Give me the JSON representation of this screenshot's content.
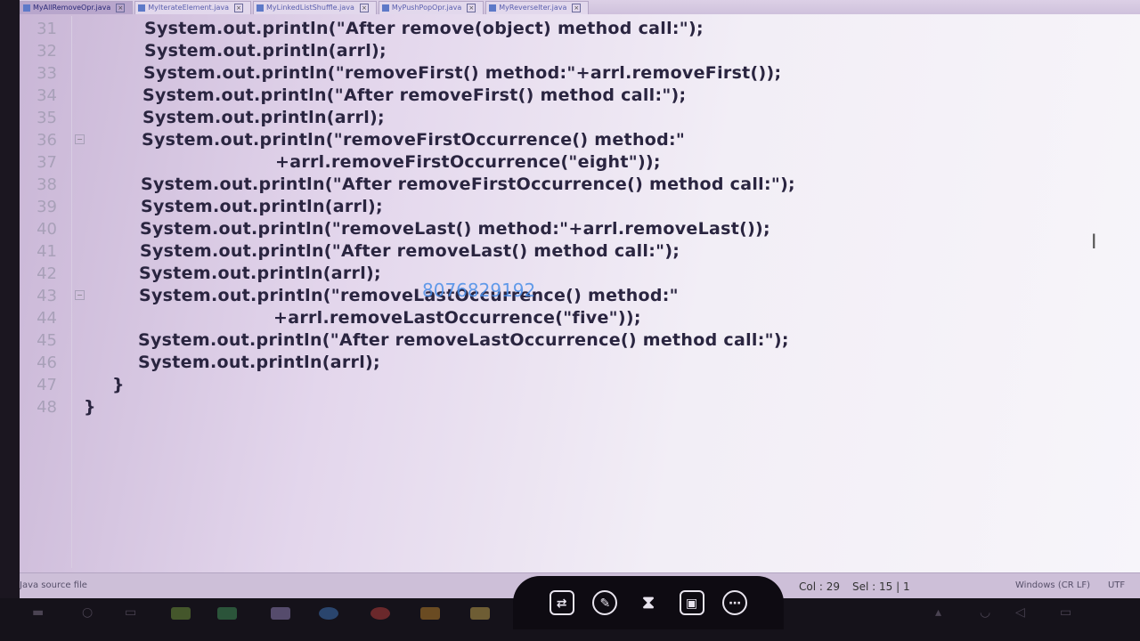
{
  "tabs": [
    {
      "label": "MyAllRemoveOpr.java",
      "active": true
    },
    {
      "label": "MyIterateElement.java",
      "active": false
    },
    {
      "label": "MyLinkedListShuffle.java",
      "active": false
    },
    {
      "label": "MyPushPopOpr.java",
      "active": false
    },
    {
      "label": "MyReverseIter.java",
      "active": false
    }
  ],
  "code_lines": [
    {
      "num": "31",
      "text": "System.out.println(\"After remove(object) method call:\");"
    },
    {
      "num": "32",
      "text": "System.out.println(arrl);"
    },
    {
      "num": "33",
      "text": "System.out.println(\"removeFirst() method:\"+arrl.removeFirst());"
    },
    {
      "num": "34",
      "text": "System.out.println(\"After removeFirst() method call:\");"
    },
    {
      "num": "35",
      "text": "System.out.println(arrl);"
    },
    {
      "num": "36",
      "text": "System.out.println(\"removeFirstOccurrence() method:\""
    },
    {
      "num": "37",
      "text": "+arrl.removeFirstOccurrence(\"eight\"));"
    },
    {
      "num": "38",
      "text": "System.out.println(\"After removeFirstOccurrence() method call:\");"
    },
    {
      "num": "39",
      "text": "System.out.println(arrl);"
    },
    {
      "num": "40",
      "text": "System.out.println(\"removeLast() method:\"+arrl.removeLast());"
    },
    {
      "num": "41",
      "text": "System.out.println(\"After removeLast() method call:\");"
    },
    {
      "num": "42",
      "text": "System.out.println(arrl);"
    },
    {
      "num": "43",
      "text": "System.out.println(\"removeLastOccurrence() method:\""
    },
    {
      "num": "44",
      "text": "+arrl.removeLastOccurrence(\"five\"));"
    },
    {
      "num": "45",
      "text": "System.out.println(\"After removeLastOccurrence() method call:\");"
    },
    {
      "num": "46",
      "text": "System.out.println(arrl);"
    },
    {
      "num": "47",
      "text": "}"
    },
    {
      "num": "48",
      "text": "}"
    }
  ],
  "watermark": "8076829192",
  "status": {
    "file_type": "Java source file",
    "col": "Col : 29",
    "sel": "Sel : 15 | 1",
    "line_endings": "Windows (CR LF)",
    "encoding": "UTF"
  },
  "overlay_tools": [
    {
      "icon": "swap-icon",
      "glyph": "⇄"
    },
    {
      "icon": "pen-icon",
      "glyph": "✎"
    },
    {
      "icon": "hourglass-icon",
      "glyph": "⧗"
    },
    {
      "icon": "image-icon",
      "glyph": "▣"
    },
    {
      "icon": "more-icon",
      "glyph": "⋯"
    }
  ]
}
